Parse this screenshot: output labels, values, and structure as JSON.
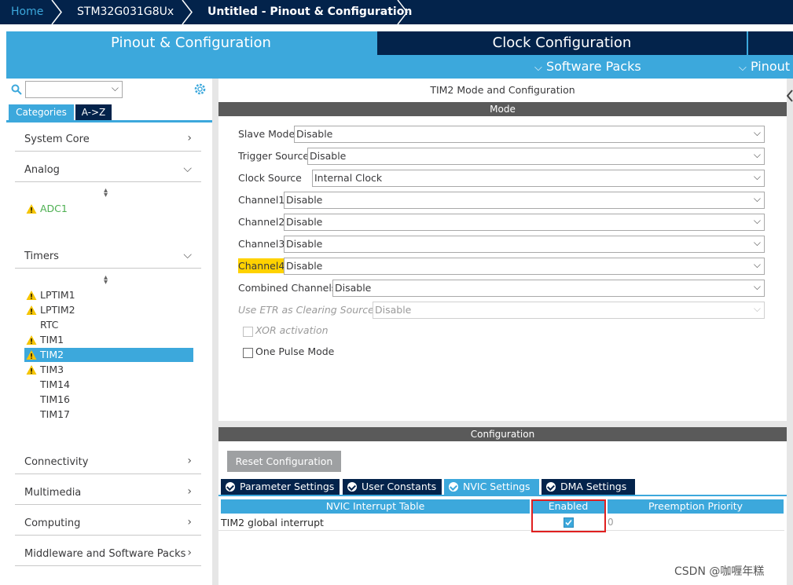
{
  "breadcrumb": {
    "home": "Home",
    "device": "STM32G031G8Ux",
    "project": "Untitled - Pinout & Configuration"
  },
  "tabs": {
    "pinout": "Pinout & Configuration",
    "clock": "Clock Configuration",
    "software_packs": "Software Packs",
    "pinout_menu": "Pinout"
  },
  "left": {
    "search_value": "",
    "categories_tab": "Categories",
    "az_tab": "A->Z",
    "system_core": "System Core",
    "analog": "Analog",
    "analog_items": [
      "ADC1"
    ],
    "timers": "Timers",
    "timer_items": [
      "LPTIM1",
      "LPTIM2",
      "RTC",
      "TIM1",
      "TIM2",
      "TIM3",
      "TIM14",
      "TIM16",
      "TIM17"
    ],
    "connectivity": "Connectivity",
    "multimedia": "Multimedia",
    "computing": "Computing",
    "middleware": "Middleware and Software Packs"
  },
  "mode": {
    "title": "TIM2 Mode and Configuration",
    "section": "Mode",
    "slave_mode": {
      "label": "Slave Mode",
      "value": "Disable"
    },
    "trigger_source": {
      "label": "Trigger Source",
      "value": "Disable"
    },
    "clock_source": {
      "label": "Clock Source",
      "value": "Internal Clock"
    },
    "channel1": {
      "label": "Channel1",
      "value": "Disable"
    },
    "channel2": {
      "label": "Channel2",
      "value": "Disable"
    },
    "channel3": {
      "label": "Channel3",
      "value": "Disable"
    },
    "channel4": {
      "label": "Channel4",
      "value": "Disable"
    },
    "combined": {
      "label": "Combined Channels",
      "value": "Disable"
    },
    "etr": {
      "label": "Use ETR as Clearing Source",
      "value": "Disable"
    },
    "xor": "XOR activation",
    "one_pulse": "One Pulse Mode"
  },
  "config": {
    "section": "Configuration",
    "reset": "Reset Configuration",
    "tabs": [
      "Parameter Settings",
      "User Constants",
      "NVIC Settings",
      "DMA Settings"
    ],
    "table": {
      "headers": [
        "NVIC Interrupt Table",
        "Enabled",
        "Preemption Priority"
      ],
      "rows": [
        {
          "name": "TIM2 global interrupt",
          "enabled": true,
          "priority": "0"
        }
      ]
    }
  },
  "watermark": "CSDN @咖喱年糕",
  "colors": {
    "navy": "#03234b",
    "blue": "#3ca8dc",
    "warning": "#f5c400",
    "highlight": "#ffd200",
    "green_text": "#4caf50",
    "red_outline": "#e02020"
  }
}
